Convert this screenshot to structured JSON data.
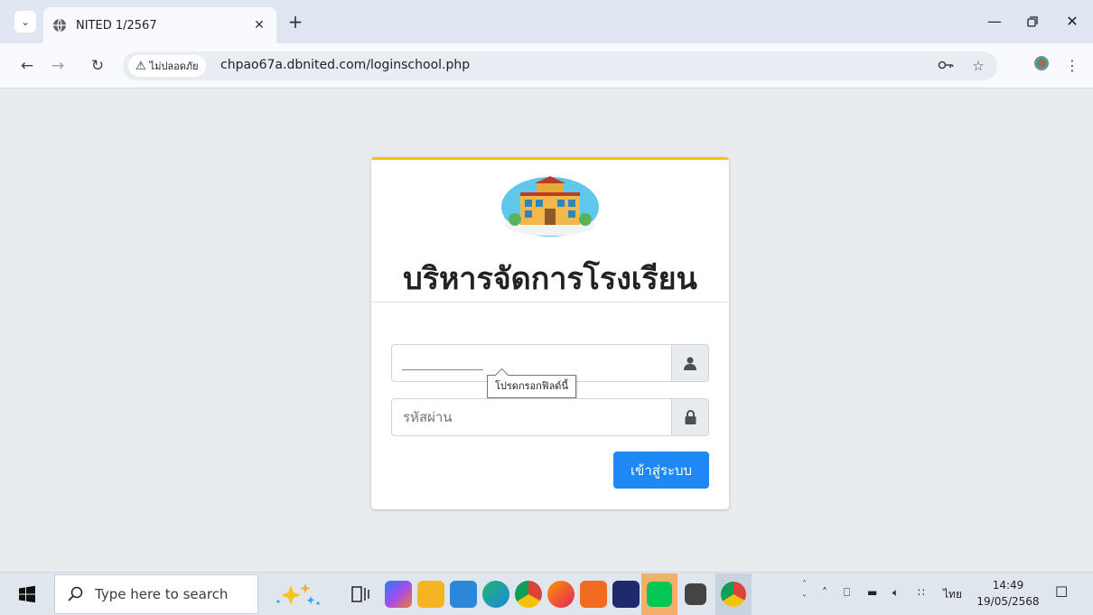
{
  "browser": {
    "tab_title": "NITED 1/2567",
    "security_label": "ไม่ปลอดภัย",
    "url": "chpao67a.dbnited.com/loginschool.php"
  },
  "login": {
    "title": "บริหารจัดการโรงเรียน",
    "username_value": "",
    "password_placeholder": "รหัสผ่าน",
    "tooltip": "โปรดกรอกฟิลด์นี้",
    "submit_label": "เข้าสู่ระบบ"
  },
  "taskbar": {
    "search_placeholder": "Type here to search",
    "language": "ไทย",
    "time": "14:49",
    "date": "19/05/2568"
  },
  "icons": [
    "chevron-down-icon",
    "globe-icon",
    "close-icon",
    "plus-icon",
    "minimize-icon",
    "restore-icon",
    "back-icon",
    "forward-icon",
    "reload-icon",
    "warning-icon",
    "key-icon",
    "star-icon",
    "profile-icon",
    "menu-icon",
    "user-icon",
    "lock-icon",
    "windows-icon",
    "search-icon"
  ],
  "colors": {
    "accent": "#1e88f5",
    "card_top_border": "#ffc107",
    "page_bg": "#e9ecef"
  }
}
